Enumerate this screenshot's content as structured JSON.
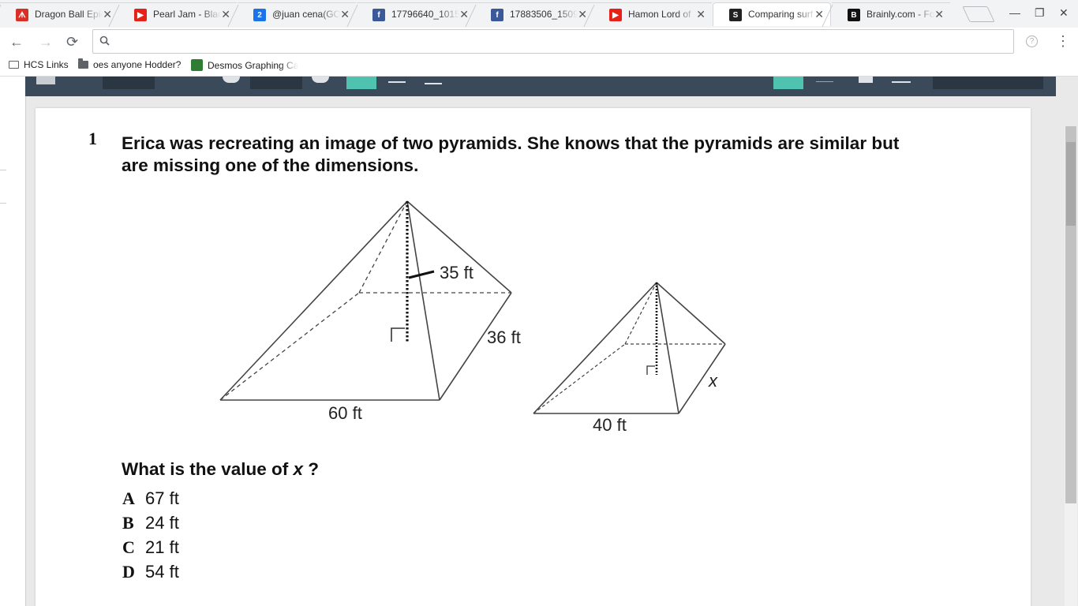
{
  "browser": {
    "tabs": [
      {
        "title": "Dragon Ball Epic",
        "favicon_color": "#d93025",
        "favicon_glyph": "ᗑ"
      },
      {
        "title": "Pearl Jam - Black",
        "favicon_color": "#e62117",
        "favicon_glyph": "▶"
      },
      {
        "title": "@juan cena(GO",
        "favicon_color": "#1a73e8",
        "favicon_glyph": "2"
      },
      {
        "title": "17796640_1015",
        "favicon_color": "#3b5998",
        "favicon_glyph": "f"
      },
      {
        "title": "17883506_1509",
        "favicon_color": "#3b5998",
        "favicon_glyph": "f"
      },
      {
        "title": "Hamon Lord of",
        "favicon_color": "#e62117",
        "favicon_glyph": "▶"
      },
      {
        "title": "Comparing surf",
        "favicon_color": "#222222",
        "favicon_glyph": "S",
        "active": true
      },
      {
        "title": "Brainly.com - Fo",
        "favicon_color": "#111111",
        "favicon_glyph": "B"
      }
    ],
    "tab_close_glyph": "✕",
    "window_controls": {
      "minimize": "—",
      "restore": "❐",
      "close": "✕"
    },
    "nav": {
      "back": "←",
      "forward": "→",
      "reload": "⟳",
      "menu": "⋮",
      "info": "?"
    },
    "omnibox": {
      "value": "",
      "icon": "search-icon"
    },
    "bookmarks": [
      {
        "label": "HCS Links",
        "icon": "apps-folder-icon"
      },
      {
        "label": "oes anyone Hodder?",
        "icon": "folder-icon"
      },
      {
        "label": "Desmos Graphing Ca",
        "icon": "desmos-icon"
      }
    ]
  },
  "question": {
    "number": "1",
    "text": "Erica was recreating an image of two pyramids.  She knows that the pyramids are similar but are missing one of the dimensions.",
    "prompt_prefix": "What is the value of ",
    "prompt_var": "x",
    "prompt_suffix": " ?",
    "choices": [
      {
        "letter": "A",
        "value": "67 ft"
      },
      {
        "letter": "B",
        "value": "24 ft"
      },
      {
        "letter": "C",
        "value": "21 ft"
      },
      {
        "letter": "D",
        "value": "54 ft"
      }
    ]
  },
  "figure": {
    "large": {
      "slant_label": "35 ft",
      "edge_label": "36 ft",
      "base_label": "60 ft"
    },
    "small": {
      "edge_label": "x",
      "base_label": "40 ft"
    }
  }
}
